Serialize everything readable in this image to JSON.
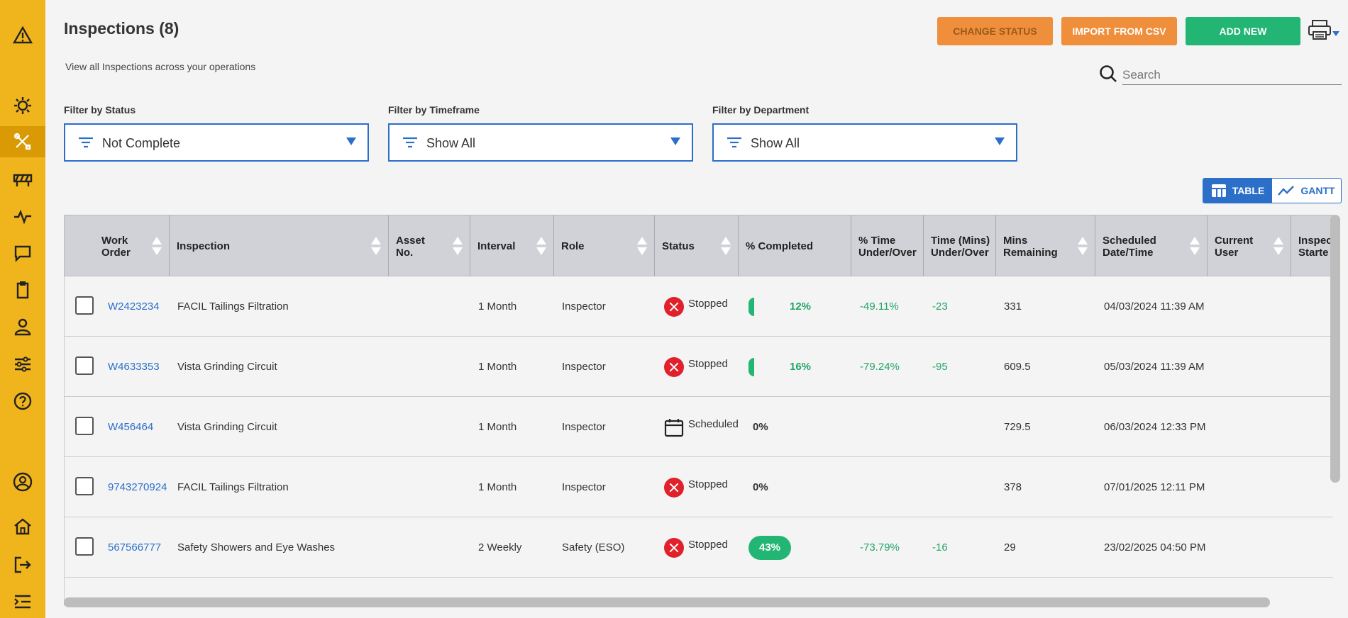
{
  "sidebar": {
    "items": [
      {
        "name": "alert-icon"
      },
      {
        "name": "settings-sun-icon"
      },
      {
        "name": "tools-icon"
      },
      {
        "name": "barrier-icon"
      },
      {
        "name": "pulse-icon"
      },
      {
        "name": "chat-icon"
      },
      {
        "name": "clipboard-icon"
      },
      {
        "name": "user-icon"
      },
      {
        "name": "sliders-icon"
      },
      {
        "name": "help-icon"
      },
      {
        "name": "account-icon"
      },
      {
        "name": "home-icon"
      },
      {
        "name": "logout-icon"
      },
      {
        "name": "menu-collapse-icon"
      }
    ]
  },
  "header": {
    "title": "Inspections (8)",
    "subtitle": "View all Inspections across your operations"
  },
  "toolbar": {
    "change_status": "CHANGE STATUS",
    "import_csv": "IMPORT FROM CSV",
    "add_new": "ADD NEW"
  },
  "search": {
    "placeholder": "Search"
  },
  "filters": [
    {
      "label": "Filter by Status",
      "value": "Not Complete"
    },
    {
      "label": "Filter by Timeframe",
      "value": "Show All"
    },
    {
      "label": "Filter by Department",
      "value": "Show All"
    }
  ],
  "view_toggle": {
    "table": "TABLE",
    "gantt": "GANTT",
    "active": "table"
  },
  "table": {
    "columns": [
      "Work Order",
      "Inspection",
      "Asset No.",
      "Interval",
      "Role",
      "Status",
      "% Completed",
      "% Time Under/Over",
      "Time (Mins) Under/Over",
      "Mins Remaining",
      "Scheduled Date/Time",
      "Current User",
      "Inspec Starte"
    ],
    "rows": [
      {
        "work_order": "W2423234",
        "inspection": "FACIL Tailings Filtration",
        "asset": "",
        "interval": "1 Month",
        "role": "Inspector",
        "status": "Stopped",
        "completed": "12%",
        "time_pct": "-49.11%",
        "time_mins": "-23",
        "mins_remaining": "331",
        "scheduled": "04/03/2024 11:39 AM",
        "user": ""
      },
      {
        "work_order": "W4633353",
        "inspection": "Vista Grinding Circuit",
        "asset": "",
        "interval": "1 Month",
        "role": "Inspector",
        "status": "Stopped",
        "completed": "16%",
        "time_pct": "-79.24%",
        "time_mins": "-95",
        "mins_remaining": "609.5",
        "scheduled": "05/03/2024 11:39 AM",
        "user": ""
      },
      {
        "work_order": "W456464",
        "inspection": "Vista Grinding Circuit",
        "asset": "",
        "interval": "1 Month",
        "role": "Inspector",
        "status": "Scheduled",
        "completed": "0%",
        "time_pct": "",
        "time_mins": "",
        "mins_remaining": "729.5",
        "scheduled": "06/03/2024 12:33 PM",
        "user": ""
      },
      {
        "work_order": "9743270924",
        "inspection": "FACIL Tailings Filtration",
        "asset": "",
        "interval": "1 Month",
        "role": "Inspector",
        "status": "Stopped",
        "completed": "0%",
        "time_pct": "",
        "time_mins": "",
        "mins_remaining": "378",
        "scheduled": "07/01/2025 12:11 PM",
        "user": ""
      },
      {
        "work_order": "567566777",
        "inspection": "Safety Showers and Eye Washes",
        "asset": "",
        "interval": "2 Weekly",
        "role": "Safety (ESO)",
        "status": "Stopped",
        "completed": "43%",
        "time_pct": "-73.79%",
        "time_mins": "-16",
        "mins_remaining": "29",
        "scheduled": "23/02/2025 04:50 PM",
        "user": ""
      }
    ]
  },
  "colors": {
    "sidebar": "#f0b41c",
    "accent": "#2b6fc9",
    "orange": "#ef8f3c",
    "green": "#22b573",
    "stopped": "#e0202a"
  }
}
